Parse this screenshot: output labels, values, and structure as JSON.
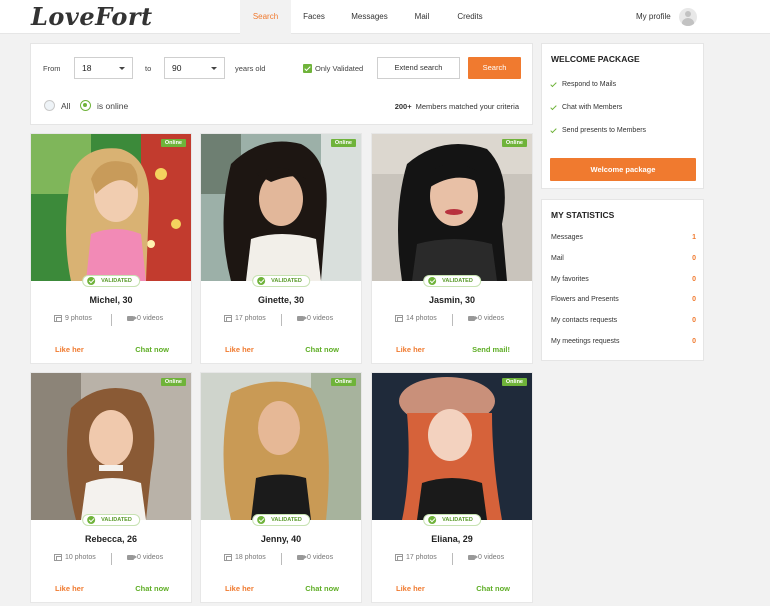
{
  "header": {
    "logo": "LoveFort",
    "nav": [
      "Search",
      "Faces",
      "Messages",
      "Mail",
      "Credits"
    ],
    "profile_label": "My profile"
  },
  "search": {
    "from_label": "From",
    "from_value": "18",
    "to_label": "to",
    "to_value": "90",
    "years_label": "years old",
    "only_validated_label": "Only Validated",
    "only_validated_checked": true,
    "extend_label": "Extend search",
    "search_label": "Search",
    "filter_all_label": "All",
    "filter_online_label": "is online",
    "selected_filter": "is online",
    "match_count": "200+",
    "match_text": "Members matched your criteria"
  },
  "profiles": [
    {
      "name": "Michel, 30",
      "badge": "Online",
      "validated": "VALIDATED",
      "photos": "9 photos",
      "videos": "0 videos",
      "like": "Like her",
      "action": "Chat now"
    },
    {
      "name": "Ginette, 30",
      "badge": "Online",
      "validated": "VALIDATED",
      "photos": "17 photos",
      "videos": "0 videos",
      "like": "Like her",
      "action": "Chat now"
    },
    {
      "name": "Jasmin, 30",
      "badge": "Online",
      "validated": "VALIDATED",
      "photos": "14 photos",
      "videos": "0 videos",
      "like": "Like her",
      "action": "Send mail!"
    },
    {
      "name": "Rebecca, 26",
      "badge": "Online",
      "validated": "VALIDATED",
      "photos": "10 photos",
      "videos": "0 videos",
      "like": "Like her",
      "action": "Chat now"
    },
    {
      "name": "Jenny, 40",
      "badge": "Online",
      "validated": "VALIDATED",
      "photos": "18 photos",
      "videos": "0 videos",
      "like": "Like her",
      "action": "Chat now"
    },
    {
      "name": "Eliana, 29",
      "badge": "Online",
      "validated": "VALIDATED",
      "photos": "17 photos",
      "videos": "0 videos",
      "like": "Like her",
      "action": "Chat now"
    }
  ],
  "welcome": {
    "title": "WELCOME PACKAGE",
    "items": [
      "Respond to Mails",
      "Chat with Members",
      "Send presents to Members"
    ],
    "button": "Welcome package"
  },
  "stats": {
    "title": "MY STATISTICS",
    "rows": [
      {
        "label": "Messages",
        "value": "1"
      },
      {
        "label": "Mail",
        "value": "0"
      },
      {
        "label": "My favorites",
        "value": "0"
      },
      {
        "label": "Flowers and Presents",
        "value": "0"
      },
      {
        "label": "My contacts requests",
        "value": "0"
      },
      {
        "label": "My meetings requests",
        "value": "0"
      }
    ]
  },
  "colors": {
    "accent": "#f07a2f",
    "online_green": "#6fb33a",
    "chat_green": "#5fae26",
    "background": "#f2f2f2"
  }
}
